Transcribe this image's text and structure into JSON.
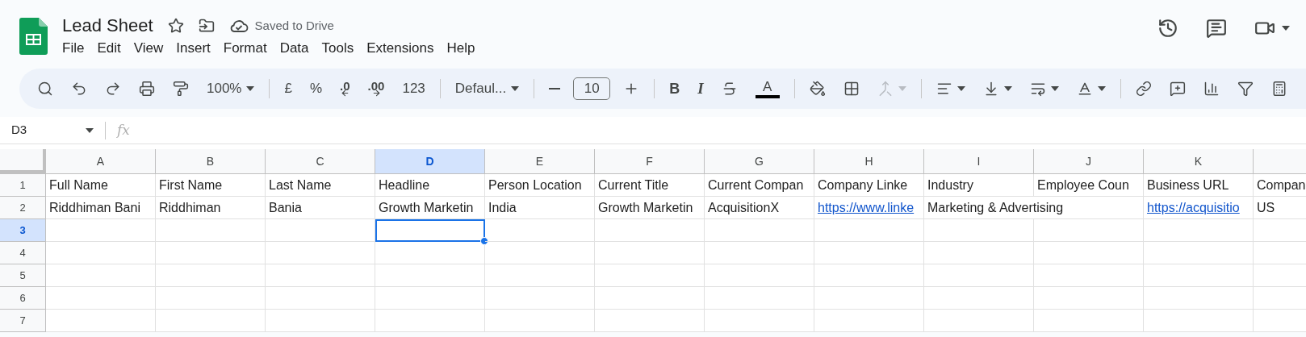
{
  "document": {
    "title": "Lead Sheet",
    "status": "Saved to Drive"
  },
  "menu": [
    "File",
    "Edit",
    "View",
    "Insert",
    "Format",
    "Data",
    "Tools",
    "Extensions",
    "Help"
  ],
  "toolbar": [
    [
      {
        "kind": "search",
        "caret": false,
        "disabled": false
      },
      {
        "kind": "undo",
        "caret": false,
        "disabled": false
      },
      {
        "kind": "redo",
        "caret": false,
        "disabled": false
      },
      {
        "kind": "print",
        "caret": false,
        "disabled": false
      },
      {
        "kind": "paint",
        "caret": false,
        "disabled": false
      },
      {
        "kind": "text",
        "label": "100%",
        "caret": true,
        "disabled": false
      }
    ],
    [
      {
        "kind": "text",
        "label": "£",
        "caret": false,
        "disabled": false
      },
      {
        "kind": "text",
        "label": "%",
        "caret": false,
        "disabled": false
      },
      {
        "kind": "decrease",
        "label": ".0",
        "caret": false,
        "disabled": false
      },
      {
        "kind": "increase",
        "label": ".00",
        "caret": false,
        "disabled": false
      },
      {
        "kind": "text",
        "label": "123",
        "caret": false,
        "disabled": false
      }
    ],
    [
      {
        "kind": "text",
        "label": "Defaul...",
        "caret": true,
        "disabled": false
      }
    ],
    [
      {
        "kind": "minus",
        "caret": false,
        "disabled": false
      },
      {
        "kind": "size",
        "label": "10",
        "caret": false,
        "disabled": false
      },
      {
        "kind": "plus",
        "caret": false,
        "disabled": false
      }
    ],
    [
      {
        "kind": "bold",
        "label": "B",
        "caret": false,
        "disabled": false
      },
      {
        "kind": "italic",
        "label": "I",
        "caret": false,
        "disabled": false
      },
      {
        "kind": "strike",
        "caret": false,
        "disabled": false
      },
      {
        "kind": "color",
        "label": "A",
        "caret": false,
        "disabled": false
      }
    ],
    [
      {
        "kind": "fill",
        "caret": false,
        "disabled": false
      },
      {
        "kind": "borders",
        "caret": false,
        "disabled": false
      },
      {
        "kind": "merge",
        "caret": true,
        "disabled": true
      }
    ],
    [
      {
        "kind": "align",
        "caret": true,
        "disabled": false
      },
      {
        "kind": "valign",
        "caret": true,
        "disabled": false
      },
      {
        "kind": "wrap",
        "caret": true,
        "disabled": false
      },
      {
        "kind": "rotate",
        "caret": true,
        "disabled": false
      }
    ],
    [
      {
        "kind": "link",
        "caret": false,
        "disabled": false
      },
      {
        "kind": "comment",
        "caret": false,
        "disabled": false
      },
      {
        "kind": "chart",
        "caret": false,
        "disabled": false
      },
      {
        "kind": "filter",
        "caret": false,
        "disabled": false
      },
      {
        "kind": "functions",
        "caret": false,
        "disabled": false
      }
    ]
  ],
  "formula_bar": {
    "name_box": "D3",
    "fx": "fx"
  },
  "columns": [
    {
      "label": "A",
      "selected": false
    },
    {
      "label": "B",
      "selected": false
    },
    {
      "label": "C",
      "selected": false
    },
    {
      "label": "D",
      "selected": true
    },
    {
      "label": "E",
      "selected": false
    },
    {
      "label": "F",
      "selected": false
    },
    {
      "label": "G",
      "selected": false
    },
    {
      "label": "H",
      "selected": false
    },
    {
      "label": "I",
      "selected": false
    },
    {
      "label": "J",
      "selected": false
    },
    {
      "label": "K",
      "selected": false
    },
    {
      "selected": false
    }
  ],
  "rows": [
    {
      "number": "1",
      "selected": false,
      "cells": [
        {
          "text": "Full Name",
          "kind": "text",
          "selected": false
        },
        {
          "text": "First Name",
          "kind": "text",
          "selected": false
        },
        {
          "text": "Last Name",
          "kind": "text",
          "selected": false
        },
        {
          "text": "Headline",
          "kind": "text",
          "selected": false
        },
        {
          "text": "Person Location",
          "kind": "text",
          "selected": false
        },
        {
          "text": "Current Title",
          "kind": "text",
          "selected": false
        },
        {
          "text": "Current Compan",
          "kind": "text",
          "selected": false
        },
        {
          "text": "Company Linke",
          "kind": "text",
          "selected": false
        },
        {
          "text": "Industry",
          "kind": "text",
          "selected": false
        },
        {
          "text": "Employee Coun",
          "kind": "text",
          "selected": false
        },
        {
          "text": "Business URL",
          "kind": "text",
          "selected": false
        },
        {
          "text": "Compan",
          "kind": "text",
          "selected": false
        }
      ]
    },
    {
      "number": "2",
      "selected": false,
      "cells": [
        {
          "text": "Riddhiman Bani",
          "kind": "text",
          "selected": false
        },
        {
          "text": "Riddhiman",
          "kind": "text",
          "selected": false
        },
        {
          "text": "Bania",
          "kind": "text",
          "selected": false
        },
        {
          "text": "Growth Marketin",
          "kind": "text",
          "selected": false
        },
        {
          "text": "India",
          "kind": "text",
          "selected": false
        },
        {
          "text": "Growth Marketin",
          "kind": "text",
          "selected": false
        },
        {
          "text": "AcquisitionX",
          "kind": "text",
          "selected": false
        },
        {
          "text": "https://www.linke",
          "kind": "link",
          "selected": false
        },
        {
          "text": "Marketing & Advertising",
          "kind": "text",
          "selected": false
        },
        {
          "selected": false
        },
        {
          "text": "https://acquisitio",
          "kind": "link",
          "selected": false
        },
        {
          "text": "US",
          "kind": "text",
          "selected": false
        }
      ]
    },
    {
      "number": "3",
      "selected": true,
      "cells": [
        {
          "kind": "text",
          "selected": false
        },
        {
          "kind": "text",
          "selected": false
        },
        {
          "kind": "text",
          "selected": false
        },
        {
          "kind": "text",
          "selected": true
        },
        {
          "kind": "text",
          "selected": false
        },
        {
          "kind": "text",
          "selected": false
        },
        {
          "kind": "text",
          "selected": false
        },
        {
          "kind": "text",
          "selected": false
        },
        {
          "kind": "text",
          "selected": false
        },
        {
          "kind": "text",
          "selected": false
        },
        {
          "kind": "text",
          "selected": false
        },
        {
          "kind": "text",
          "selected": false
        }
      ]
    },
    {
      "number": "4",
      "selected": false
    },
    {
      "number": "5",
      "selected": false
    },
    {
      "number": "6",
      "selected": false
    },
    {
      "number": "7",
      "selected": false
    }
  ]
}
